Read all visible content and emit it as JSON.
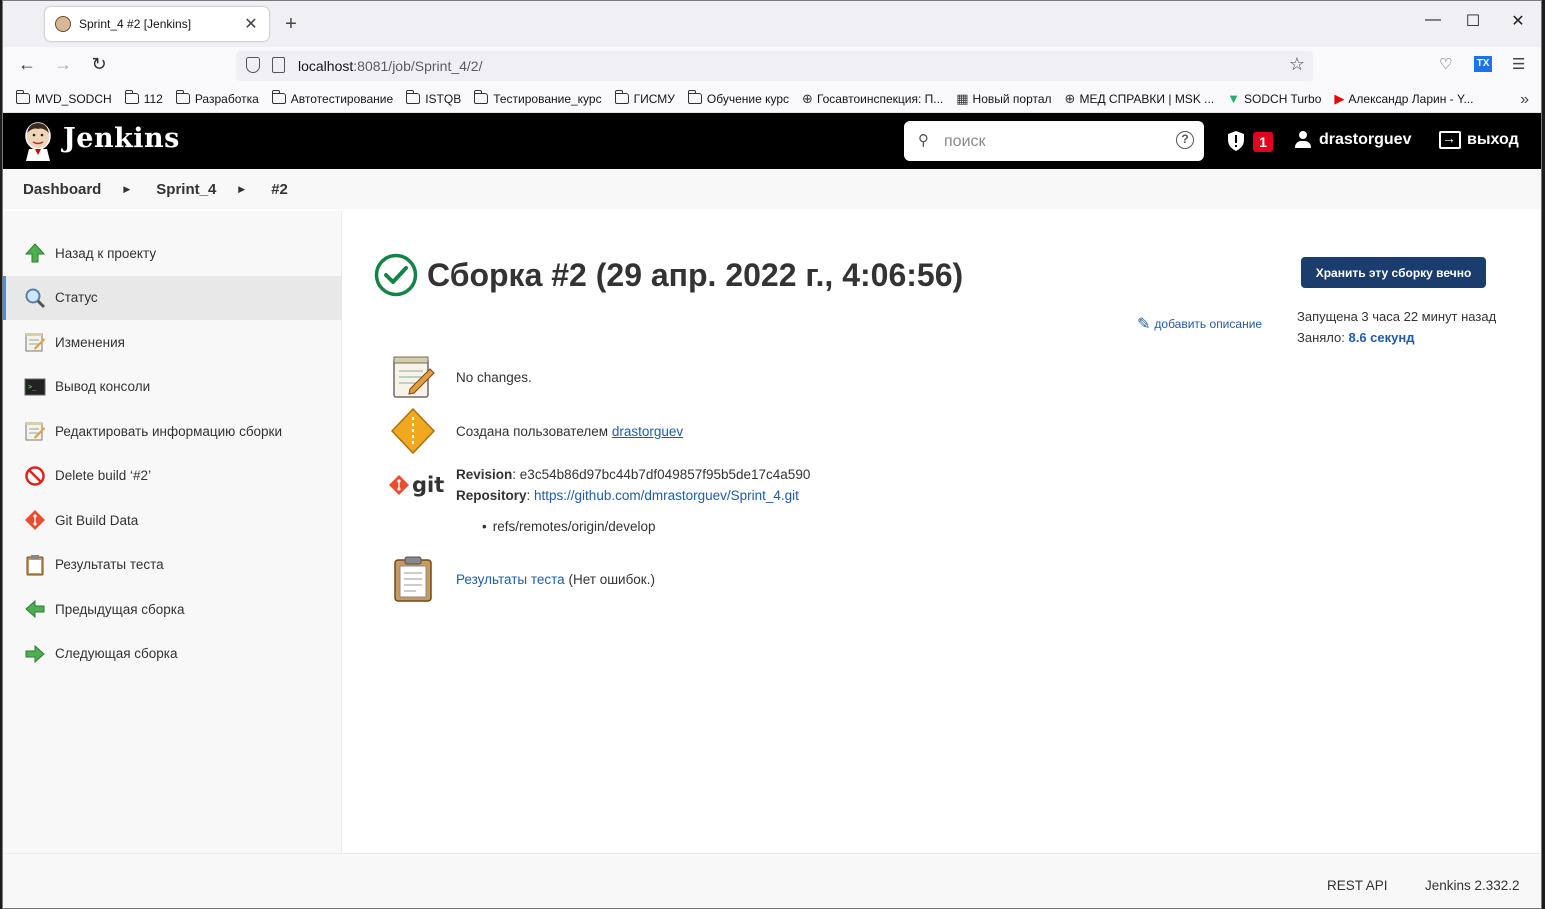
{
  "browser": {
    "tab_title": "Sprint_4 #2 [Jenkins]",
    "url_host": "localhost",
    "url_rest": ":8081/job/Sprint_4/2/",
    "bookmarks": [
      {
        "label": "MVD_SODCH",
        "icon": "folder-icon"
      },
      {
        "label": "112",
        "icon": "folder-icon"
      },
      {
        "label": "Разработка",
        "icon": "folder-icon"
      },
      {
        "label": "Автотестирование",
        "icon": "folder-icon"
      },
      {
        "label": "ISTQB",
        "icon": "folder-icon"
      },
      {
        "label": "Тестирование_курс",
        "icon": "folder-icon"
      },
      {
        "label": "ГИСМУ",
        "icon": "folder-icon"
      },
      {
        "label": "Обучение курс",
        "icon": "folder-icon"
      },
      {
        "label": "Госавтоинспекция: П...",
        "icon": "globe-icon"
      },
      {
        "label": "Новый портал",
        "icon": "portal-icon"
      },
      {
        "label": "МЕД СПРАВКИ | MSK ...",
        "icon": "globe-icon"
      },
      {
        "label": "SODCH Turbo",
        "icon": "vue-icon"
      },
      {
        "label": "Александр Ларин - Y...",
        "icon": "youtube-icon"
      }
    ]
  },
  "jenkins": {
    "brand": "Jenkins",
    "search_placeholder": "поиск",
    "security_count": "1",
    "username": "drastorguev",
    "logout": "выход"
  },
  "breadcrumb": [
    "Dashboard",
    "Sprint_4",
    "#2"
  ],
  "sidebar": [
    {
      "label": "Назад к проекту",
      "icon": "up-arrow-icon"
    },
    {
      "label": "Статус",
      "icon": "magnifier-icon",
      "active": true
    },
    {
      "label": "Изменения",
      "icon": "notepad-icon"
    },
    {
      "label": "Вывод консоли",
      "icon": "terminal-icon"
    },
    {
      "label": "Редактировать информацию сборки",
      "icon": "notepad-icon"
    },
    {
      "label": "Delete build ‘#2’",
      "icon": "no-entry-icon"
    },
    {
      "label": "Git Build Data",
      "icon": "git-icon"
    },
    {
      "label": "Результаты теста",
      "icon": "clipboard-icon"
    },
    {
      "label": "Предыдущая сборка",
      "icon": "left-arrow-icon"
    },
    {
      "label": "Следующая сборка",
      "icon": "right-arrow-icon"
    }
  ],
  "build": {
    "title": "Сборка #2 (29 апр. 2022 г., 4:06:56)",
    "keep_button": "Хранить эту сборку вечно",
    "add_description": "добавить описание",
    "started_label": "Запущена 3 часа 22 минут назад",
    "took_label": "Заняло:",
    "took_value": "8.6 секунд",
    "no_changes": "No changes.",
    "created_by_label": "Создана пользователем",
    "created_by_user": "drastorguev",
    "revision_label": "Revision",
    "revision_value": "e3c54b86d97bc44b7df049857f95b5de17c4a590",
    "repository_label": "Repository",
    "repository_value": "https://github.com/dmrastorguev/Sprint_4.git",
    "branch": "refs/remotes/origin/develop",
    "git_logo": "git",
    "test_results_link": "Результаты теста",
    "test_results_status": "(Нет ошибок.)"
  },
  "footer": {
    "rest_api": "REST API",
    "version": "Jenkins 2.332.2"
  },
  "colors": {
    "header_bg": "#000000",
    "link": "#1f5ca8",
    "success": "#138347",
    "keep_button": "#1b3d6e",
    "badge": "#e6001f"
  }
}
